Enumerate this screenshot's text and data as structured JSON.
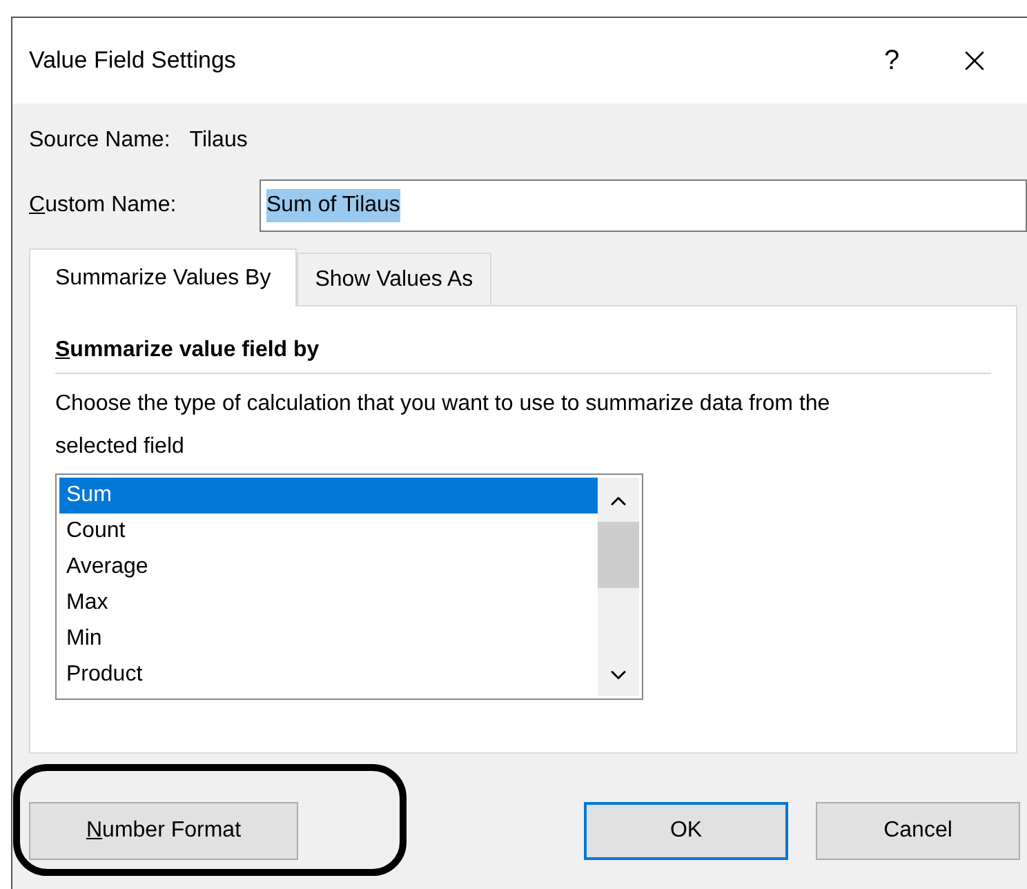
{
  "window": {
    "title": "Value Field Settings",
    "help": "?"
  },
  "source": {
    "label": "Source Name:",
    "value": "Tilaus"
  },
  "custom_name": {
    "label": "Custom Name:",
    "underline_first": true,
    "value": "Sum of Tilaus",
    "text_selected": true
  },
  "tabs": [
    {
      "label": "Summarize Values By",
      "selected": true
    },
    {
      "label": "Show Values As",
      "selected": false
    }
  ],
  "panel": {
    "heading": "Summarize value field by",
    "underline_first": true,
    "description": "Choose the type of calculation that you want to use to summarize data from the selected field"
  },
  "calculations": [
    {
      "label": "Sum",
      "selected": true
    },
    {
      "label": "Count",
      "selected": false
    },
    {
      "label": "Average",
      "selected": false
    },
    {
      "label": "Max",
      "selected": false
    },
    {
      "label": "Min",
      "selected": false
    },
    {
      "label": "Product",
      "selected": false
    }
  ],
  "buttons": [
    {
      "label": "Number Format",
      "underline_first": true,
      "default": false,
      "annotated": true
    },
    {
      "label": "OK",
      "underline_first": false,
      "default": true,
      "annotated": false
    },
    {
      "label": "Cancel",
      "underline_first": false,
      "default": false,
      "annotated": false
    }
  ]
}
